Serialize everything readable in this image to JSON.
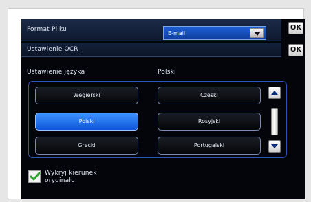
{
  "screen": {
    "format_label": "Format Pliku",
    "format_value": "E-mail",
    "ok_top": "OK",
    "ocr_label": "Ustawienie OCR",
    "ok_ocr": "OK",
    "language_setting_label": "Ustawienie języka",
    "current_language": "Polski",
    "languages_left": [
      "Węgierski",
      "Polski",
      "Grecki"
    ],
    "languages_right": [
      "Czeski",
      "Rosyjski",
      "Portugalski"
    ],
    "selected_language": "Polski",
    "detect_orientation_line1": "Wykryj kierunek",
    "detect_orientation_line2": "oryginału"
  },
  "colors": {
    "selected_blue": "#1e66ea",
    "scroll_arrow": "#0a2e7a",
    "check_green": "#2ea52e"
  },
  "icons": {
    "up": "scroll-up-arrow-icon",
    "down": "scroll-down-arrow-icon",
    "dropdown": "chevron-down-icon",
    "check": "checkmark-icon"
  }
}
